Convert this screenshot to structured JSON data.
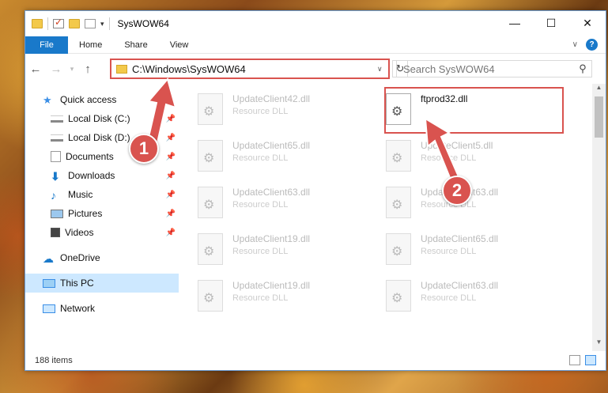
{
  "window": {
    "title": "SysWOW64",
    "controls": {
      "minimize": "—",
      "maximize": "☐",
      "close": "✕"
    }
  },
  "ribbon": {
    "tabs": [
      "File",
      "Home",
      "Share",
      "View"
    ]
  },
  "address": {
    "path": "C:\\Windows\\SysWOW64",
    "search_placeholder": "Search SysWOW64"
  },
  "sidebar": {
    "items": [
      {
        "label": "Quick access",
        "icon": "star-icon",
        "pinned": false
      },
      {
        "label": "Local Disk (C:)",
        "icon": "drive-icon",
        "pinned": true
      },
      {
        "label": "Local Disk (D:)",
        "icon": "drive-icon",
        "pinned": true
      },
      {
        "label": "Documents",
        "icon": "documents-icon",
        "pinned": true
      },
      {
        "label": "Downloads",
        "icon": "download-icon",
        "pinned": true
      },
      {
        "label": "Music",
        "icon": "music-icon",
        "pinned": true
      },
      {
        "label": "Pictures",
        "icon": "pictures-icon",
        "pinned": true
      },
      {
        "label": "Videos",
        "icon": "videos-icon",
        "pinned": true
      },
      {
        "label": "OneDrive",
        "icon": "cloud-icon",
        "pinned": false
      },
      {
        "label": "This PC",
        "icon": "computer-icon",
        "pinned": false
      },
      {
        "label": "Network",
        "icon": "network-icon",
        "pinned": false
      }
    ]
  },
  "files": [
    {
      "name": "UpdateClient42.dll",
      "type": "Resource DLL"
    },
    {
      "name": "ftprod32.dll",
      "type": ""
    },
    {
      "name": "UpdateClient65.dll",
      "type": "Resource DLL"
    },
    {
      "name": "UpdateClient5.dll",
      "type": "Resource DLL"
    },
    {
      "name": "UpdateClient63.dll",
      "type": "Resource DLL"
    },
    {
      "name": "UpdateClient63.dll",
      "type": "Resource DLL"
    },
    {
      "name": "UpdateClient19.dll",
      "type": "Resource DLL"
    },
    {
      "name": "UpdateClient65.dll",
      "type": "Resource DLL"
    },
    {
      "name": "UpdateClient19.dll",
      "type": "Resource DLL"
    },
    {
      "name": "UpdateClient63.dll",
      "type": "Resource DLL"
    }
  ],
  "status": {
    "item_count": "188 items"
  },
  "callouts": {
    "one": "1",
    "two": "2"
  },
  "colors": {
    "accent": "#1979ca",
    "highlight": "#d9534f",
    "selected": "#cde8ff"
  }
}
